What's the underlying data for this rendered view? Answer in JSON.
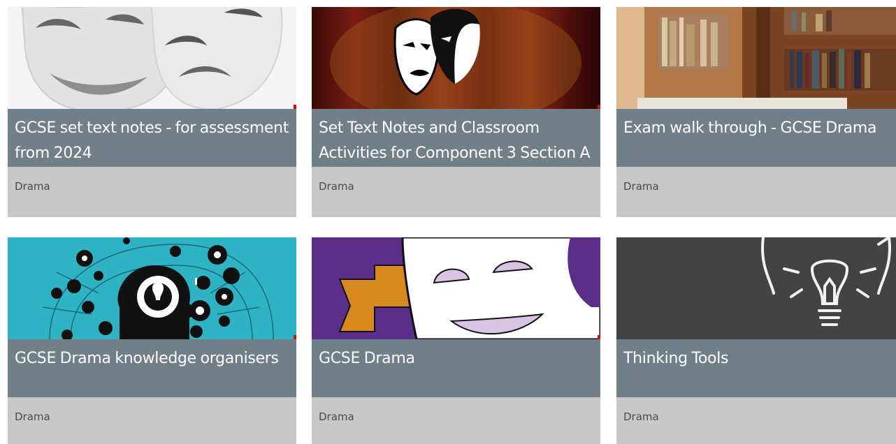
{
  "cards": [
    {
      "title": "GCSE set text notes - for assessment from 2024",
      "category": "Drama",
      "image": "theatre-masks-white"
    },
    {
      "title": "Set Text Notes and Classroom Activities for Component 3 Section A",
      "category": "Drama",
      "image": "theatre-masks-stage-curtain"
    },
    {
      "title": "Exam walk through - GCSE Drama",
      "category": "Drama",
      "image": "bookshelf-library"
    },
    {
      "title": "GCSE Drama knowledge organisers",
      "category": "Drama",
      "image": "head-lightbulb-icons"
    },
    {
      "title": "GCSE Drama",
      "category": "Drama",
      "image": "comedy-mask-purple"
    },
    {
      "title": "Thinking Tools",
      "category": "Drama",
      "image": "chalkboard-lightbulb"
    }
  ],
  "colors": {
    "title_bar": "#717f89",
    "category_bar": "#c8c8c8",
    "title_text": "#ffffff",
    "category_text": "#4a4a4a"
  }
}
